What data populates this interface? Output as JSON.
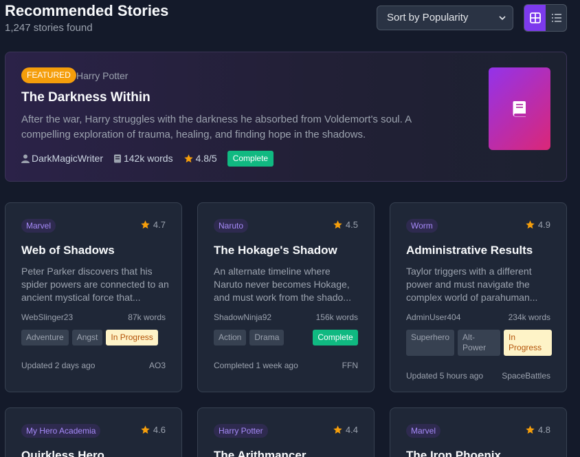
{
  "header": {
    "title": "Recommended Stories",
    "count": "1,247 stories found",
    "sort_label": "Sort by Popularity"
  },
  "featured": {
    "badge": "FEATURED",
    "fandom": "Harry Potter",
    "title": "The Darkness Within",
    "description": "After the war, Harry struggles with the darkness he absorbed from Voldemort's soul. A compelling exploration of trauma, healing, and finding hope in the shadows.",
    "author": "DarkMagicWriter",
    "words": "142k words",
    "rating": "4.8/5",
    "status": "Complete"
  },
  "cards": [
    {
      "fandom": "Marvel",
      "rating": "4.7",
      "title": "Web of Shadows",
      "description": "Peter Parker discovers that his spider powers are connected to an ancient mystical force that...",
      "author": "WebSlinger23",
      "words": "87k words",
      "tags": [
        "Adventure",
        "Angst"
      ],
      "status": "In Progress",
      "updated": "Updated 2 days ago",
      "site": "AO3"
    },
    {
      "fandom": "Naruto",
      "rating": "4.5",
      "title": "The Hokage's Shadow",
      "description": "An alternate timeline where Naruto never becomes Hokage, and must work from the shado...",
      "author": "ShadowNinja92",
      "words": "156k words",
      "tags": [
        "Action",
        "Drama"
      ],
      "status": "Complete",
      "updated": "Completed 1 week ago",
      "site": "FFN"
    },
    {
      "fandom": "Worm",
      "rating": "4.9",
      "title": "Administrative Results",
      "description": "Taylor triggers with a different power and must navigate the complex world of parahuman...",
      "author": "AdminUser404",
      "words": "234k words",
      "tags": [
        "Superhero",
        "Alt-Power"
      ],
      "status": "In Progress",
      "updated": "Updated 5 hours ago",
      "site": "SpaceBattles"
    },
    {
      "fandom": "My Hero Academia",
      "rating": "4.6",
      "title": "Quirkless Hero"
    },
    {
      "fandom": "Harry Potter",
      "rating": "4.4",
      "title": "The Arithmancer"
    },
    {
      "fandom": "Marvel",
      "rating": "4.8",
      "title": "The Iron Phoenix"
    }
  ],
  "colors": {
    "background": "#141a2a",
    "card": "#1f2737",
    "accent": "#7c3aed",
    "featured_badge": "#f59e0b",
    "complete": "#10b981",
    "in_progress_bg": "#fef3c7",
    "star": "#f59e0b"
  },
  "icons": [
    "chevron-down-icon",
    "grid-view-icon",
    "list-view-icon",
    "book-icon",
    "user-icon",
    "words-icon",
    "star-icon"
  ]
}
